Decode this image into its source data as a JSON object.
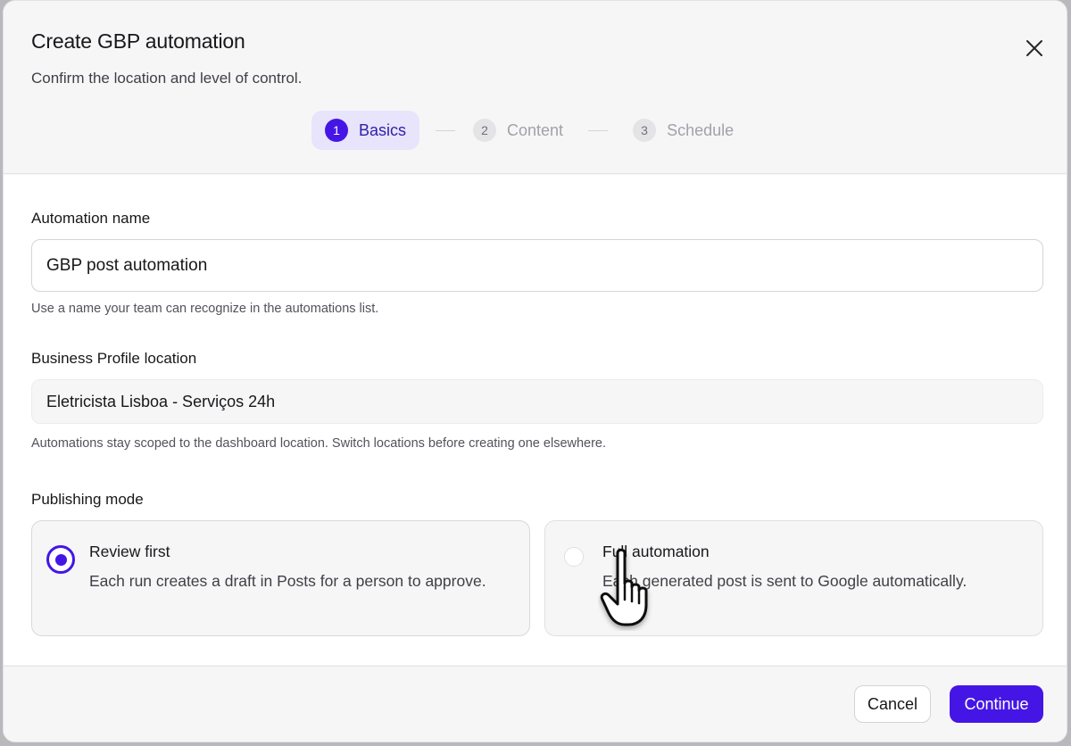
{
  "dialog": {
    "title": "Create GBP automation",
    "subtitle": "Confirm the location and level of control."
  },
  "stepper": {
    "steps": [
      {
        "number": "1",
        "label": "Basics",
        "active": true
      },
      {
        "number": "2",
        "label": "Content",
        "active": false
      },
      {
        "number": "3",
        "label": "Schedule",
        "active": false
      }
    ]
  },
  "form": {
    "name": {
      "label": "Automation name",
      "value": "GBP post automation",
      "help": "Use a name your team can recognize in the automations list."
    },
    "location": {
      "label": "Business Profile location",
      "value": "Eletricista Lisboa - Serviços 24h",
      "help": "Automations stay scoped to the dashboard location. Switch locations before creating one elsewhere."
    },
    "publishing_mode": {
      "label": "Publishing mode",
      "options": [
        {
          "title": "Review first",
          "description": "Each run creates a draft in Posts for a person to approve.",
          "selected": true
        },
        {
          "title": "Full automation",
          "description": "Each generated post is sent to Google automatically.",
          "selected": false
        }
      ]
    }
  },
  "footer": {
    "cancel_label": "Cancel",
    "continue_label": "Continue"
  },
  "colors": {
    "accent": "#4515e6",
    "accent_soft": "#e7e4fb",
    "border": "#d4d4d8"
  },
  "icons": {
    "close": "close-icon",
    "cursor": "hand-pointer-icon"
  }
}
